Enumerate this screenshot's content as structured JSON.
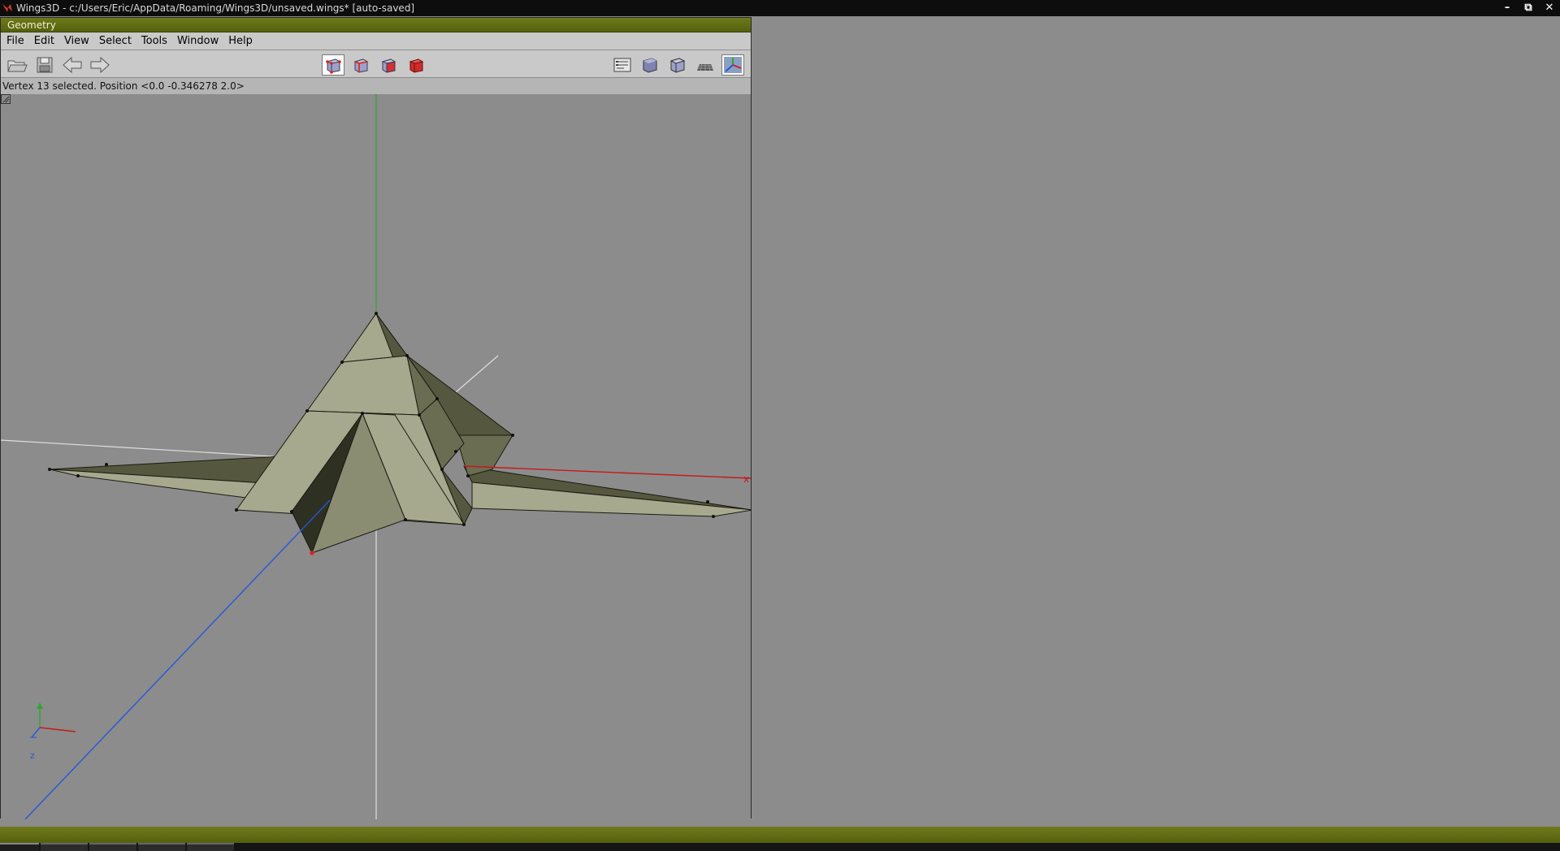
{
  "window": {
    "title": "Wings3D - c:/Users/Eric/AppData/Roaming/Wings3D/unsaved.wings* [auto-saved]",
    "controls": {
      "minimize": "minimize-icon",
      "restore": "restore-icon",
      "close": "close-icon"
    }
  },
  "geometry_window": {
    "title": "Geometry",
    "menu": [
      "File",
      "Edit",
      "View",
      "Select",
      "Tools",
      "Window",
      "Help"
    ],
    "toolbar": {
      "left_buttons": [
        "open-file-icon",
        "save-file-icon",
        "undo-arrow-icon",
        "redo-arrow-icon"
      ],
      "selection_modes": [
        {
          "name": "vertex-mode-icon",
          "active": true
        },
        {
          "name": "edge-mode-icon",
          "active": false
        },
        {
          "name": "face-mode-icon",
          "active": false
        },
        {
          "name": "body-mode-icon",
          "active": false
        }
      ],
      "view_buttons": [
        {
          "name": "groundplane-toggle-icon",
          "active": false
        },
        {
          "name": "smooth-shading-icon",
          "active": false
        },
        {
          "name": "flat-shading-icon",
          "active": false
        },
        {
          "name": "wireframe-icon",
          "active": false
        },
        {
          "name": "show-axes-icon",
          "active": true
        }
      ]
    },
    "status": "Vertex 13 selected. Position <0.0  -0.346278  2.0>",
    "viewport": {
      "axis_labels": {
        "x": "x",
        "z": "z"
      },
      "colors": {
        "background": "#8c8c8c",
        "mesh_light": "#a6a98d",
        "mesh_dark": "#55583f",
        "x_axis": "#c81818",
        "y_axis": "#2ca82c",
        "z_axis": "#2457d8",
        "selected_vertex": "#e02020"
      }
    }
  }
}
